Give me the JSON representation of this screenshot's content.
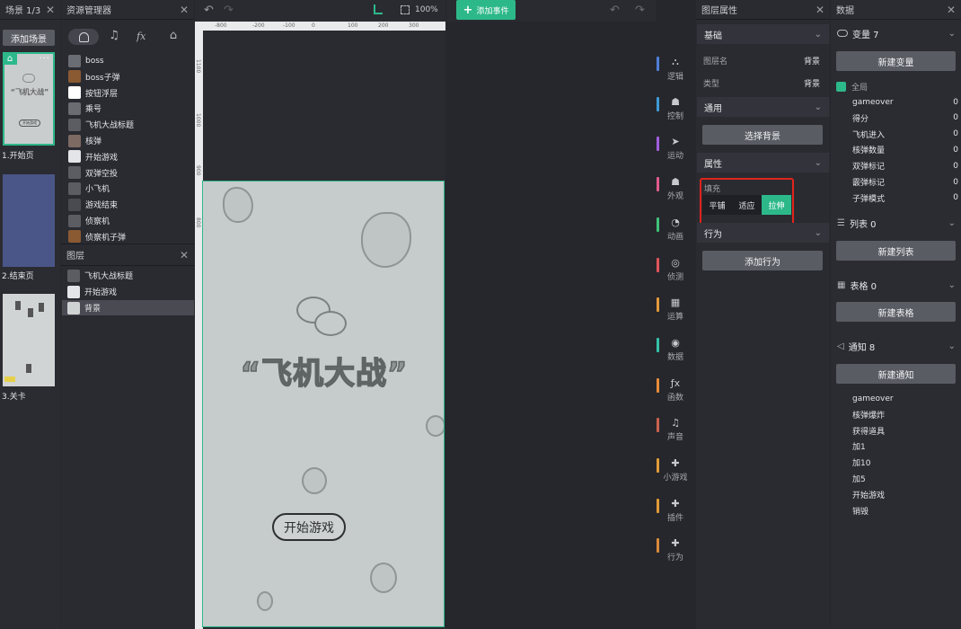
{
  "scenes": {
    "header": "场景 1/3",
    "add_button": "添加场景",
    "items": [
      {
        "label": "1.开始页"
      },
      {
        "label": "2.结束页"
      },
      {
        "label": "3.关卡"
      }
    ],
    "thumb_title": "“飞机大战”",
    "thumb_button": "开始游戏"
  },
  "resources": {
    "header": "资源管理器",
    "tabs": [
      "ghost-icon",
      "music-icon",
      "fx",
      "puzzle-icon"
    ],
    "fx_label": "fx",
    "items": [
      {
        "label": "boss"
      },
      {
        "label": "boss子弹"
      },
      {
        "label": "按钮浮层"
      },
      {
        "label": "乘号"
      },
      {
        "label": "飞机大战标题"
      },
      {
        "label": "核弹"
      },
      {
        "label": "开始游戏"
      },
      {
        "label": "双弹空投"
      },
      {
        "label": "小飞机"
      },
      {
        "label": "游戏结束"
      },
      {
        "label": "侦察机"
      },
      {
        "label": "侦察机子弹"
      }
    ]
  },
  "layers": {
    "header": "图层",
    "items": [
      {
        "label": "飞机大战标题"
      },
      {
        "label": "开始游戏"
      },
      {
        "label": "背景"
      }
    ]
  },
  "canvas": {
    "zoom": "100%",
    "ruler_ticks": [
      "-800",
      "-200",
      "-100",
      "0",
      "100",
      "200",
      "300"
    ],
    "vruler_ticks": [
      "1100",
      "1000",
      "900",
      "800"
    ],
    "game_title": "“飞机大战”",
    "start_button": "开始游戏"
  },
  "events": {
    "add_event": "添加事件"
  },
  "categories": [
    {
      "label": "逻辑",
      "color": "#4f7fd8",
      "glyph": "⛬"
    },
    {
      "label": "控制",
      "color": "#3f9bd6",
      "glyph": "☗"
    },
    {
      "label": "运动",
      "color": "#a25ee0",
      "glyph": "➤"
    },
    {
      "label": "外观",
      "color": "#e05b8c",
      "glyph": "☗"
    },
    {
      "label": "动画",
      "color": "#3fc17a",
      "glyph": "◔"
    },
    {
      "label": "侦测",
      "color": "#e0545a",
      "glyph": "◎"
    },
    {
      "label": "运算",
      "color": "#e39a3c",
      "glyph": "▦"
    },
    {
      "label": "数据",
      "color": "#33c3a9",
      "glyph": "◉"
    },
    {
      "label": "函数",
      "color": "#e98c3a",
      "glyph": "ƒx"
    },
    {
      "label": "声音",
      "color": "#c9634e",
      "glyph": "♫"
    },
    {
      "label": "小游戏",
      "color": "#e29c37",
      "glyph": "✚"
    },
    {
      "label": "插件",
      "color": "#e19b35",
      "glyph": "✚"
    },
    {
      "label": "行为",
      "color": "#d98a3c",
      "glyph": "✚"
    }
  ],
  "layer_props": {
    "header": "图层属性",
    "basic": "基础",
    "name_label": "图层名",
    "name_value": "背景",
    "type_label": "类型",
    "type_value": "背景",
    "general": "通用",
    "select_bg": "选择背景",
    "attributes": "属性",
    "fill_label": "填充",
    "fill_options": [
      "平铺",
      "适应",
      "拉伸"
    ],
    "fill_selected": "拉伸",
    "behavior": "行为",
    "add_behavior": "添加行为"
  },
  "data_panel": {
    "header": "数据",
    "variables_title": "变量 7",
    "new_variable": "新建变量",
    "global_label": "全局",
    "variables": [
      {
        "name": "gameover",
        "value": "0"
      },
      {
        "name": "得分",
        "value": "0"
      },
      {
        "name": "飞机进入",
        "value": "0"
      },
      {
        "name": "核弹数量",
        "value": "0"
      },
      {
        "name": "双弹标记",
        "value": "0"
      },
      {
        "name": "霰弹标记",
        "value": "0"
      },
      {
        "name": "子弹模式",
        "value": "0"
      }
    ],
    "lists_title": "列表 0",
    "new_list": "新建列表",
    "tables_title": "表格 0",
    "new_table": "新建表格",
    "notices_title": "通知 8",
    "new_notice": "新建通知",
    "notices": [
      "gameover",
      "核弹爆炸",
      "获得道具",
      "加1",
      "加10",
      "加5",
      "开始游戏",
      "销毁"
    ]
  },
  "colors": {
    "accent": "#2db88a",
    "highlight_box": "#e0241b",
    "canvas_bg": "#c6cbcc"
  }
}
